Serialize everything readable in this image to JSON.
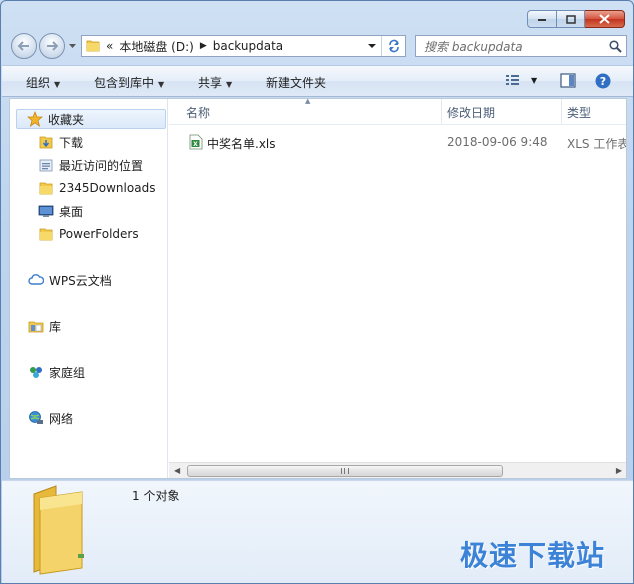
{
  "window": {
    "caption_buttons": [
      "minimize-icon",
      "maximize-icon",
      "close-icon"
    ]
  },
  "nav": {
    "address_overflow": "«",
    "address_segments": [
      "本地磁盘 (D:)",
      "backupdata"
    ],
    "search_placeholder": "搜索 backupdata"
  },
  "toolbar": {
    "organize": "组织",
    "include_in_library": "包含到库中",
    "share": "共享",
    "new_folder": "新建文件夹"
  },
  "sidebar": {
    "favorites": {
      "label": "收藏夹",
      "items": [
        "下载",
        "最近访问的位置",
        "2345Downloads",
        "桌面",
        "PowerFolders"
      ]
    },
    "wps_cloud": "WPS云文档",
    "libraries": "库",
    "homegroup": "家庭组",
    "network": "网络"
  },
  "columns": {
    "name": "名称",
    "modified": "修改日期",
    "type": "类型"
  },
  "files": [
    {
      "name": "中奖名单.xls",
      "modified": "2018-09-06 9:48",
      "type": "XLS 工作表"
    }
  ],
  "details": {
    "count": "1 个对象"
  },
  "watermark": "极速下载站",
  "colors": {
    "accent": "#3c83d7",
    "folder": "#f2c94c",
    "close": "#c2341f"
  }
}
